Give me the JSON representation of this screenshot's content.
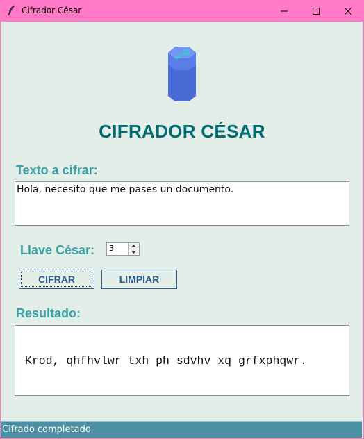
{
  "window": {
    "title": "Cifrador César"
  },
  "header": {
    "title": "CIFRADOR CÉSAR",
    "logo_icon": "key-database-icon"
  },
  "input": {
    "label": "Texto a cifrar:",
    "value": "Hola, necesito que me pases un documento."
  },
  "key": {
    "label": "Llave César:",
    "value": "3"
  },
  "buttons": {
    "cifrar": "CIFRAR",
    "limpiar": "LIMPIAR"
  },
  "output": {
    "label": "Resultado:",
    "value": "Krod, qhfhvlwr txh ph sdvhv xq grfxphqwr."
  },
  "status": {
    "text": "Cifrado completado"
  },
  "colors": {
    "titlebar": "#ff79c6",
    "background": "#e2eee7",
    "heading": "#006b73",
    "label": "#3aa2a8",
    "button_text": "#2c5c8a",
    "statusbar": "#4a8fa2",
    "logo": "#5b7de8"
  }
}
